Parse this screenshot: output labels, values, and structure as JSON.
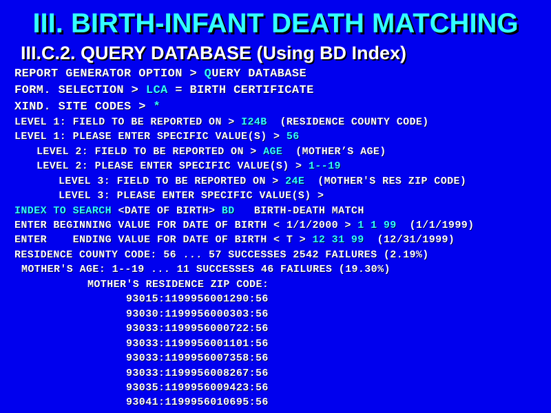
{
  "title": "III. BIRTH-INFANT DEATH MATCHING",
  "subtitle": "III.C.2. QUERY DATABASE (Using BD Index)",
  "lines": {
    "l1": {
      "a": "REPORT GENERATOR OPTION > ",
      "b": "Q",
      "c": "UERY DATABASE"
    },
    "l2": {
      "a": "FORM. SELECTION > ",
      "b": "LCA",
      "c": " = BIRTH CERTIFICATE"
    },
    "l3": {
      "a": "XIND. SITE CODES > ",
      "b": "*"
    },
    "l4": {
      "a": "LEVEL 1: FIELD TO BE REPORTED ON > ",
      "b": "I24B",
      "c": "  (RESIDENCE COUNTY CODE)"
    },
    "l5": {
      "a": "LEVEL 1: PLEASE ENTER SPECIFIC VALUE(S) > ",
      "b": "56"
    },
    "l6": {
      "a": "LEVEL 2: FIELD TO BE REPORTED ON > ",
      "b": "AGE",
      "c": "  (MOTHER’S AGE)"
    },
    "l7": {
      "a": "LEVEL 2: PLEASE ENTER SPECIFIC VALUE(S) > ",
      "b": "1--19"
    },
    "l8": {
      "a": "LEVEL 3: FIELD TO BE REPORTED ON > ",
      "b": "24E",
      "c": "  (MOTHER'S RES ZIP CODE)"
    },
    "l9": {
      "a": "LEVEL 3: PLEASE ENTER SPECIFIC VALUE(S) >"
    },
    "l10": {
      "a": "INDEX TO SEARCH ",
      "b": "<DATE OF BIRTH> ",
      "c": "BD",
      "d": "   BIRTH-DEATH MATCH"
    },
    "l11": {
      "a": "ENTER BEGINNING VALUE FOR DATE OF BIRTH < 1/1/2000 > ",
      "b": "1 1 99",
      "c": "  (1/1/1999)"
    },
    "l12": {
      "a": "ENTER    ENDING VALUE FOR DATE OF BIRTH < T > ",
      "b": "12 31 99",
      "c": "  (12/31/1999)"
    },
    "l13": {
      "a": "RESIDENCE COUNTY CODE: 56 ... 57 SUCCESSES 2542 FAILURES (2.19%)"
    },
    "l14": {
      "a": "MOTHER'S AGE: 1--19 ... 11 SUCCESSES 46 FAILURES (19.30%)"
    },
    "l15": {
      "a": "MOTHER'S RESIDENCE ZIP CODE:"
    }
  },
  "zip_records": [
    "93015:1199956001290:56",
    "93030:1199956000303:56",
    "93033:1199956000722:56",
    "93033:1199956001101:56",
    "93033:1199956007358:56",
    "93033:1199956008267:56",
    "93035:1199956009423:56",
    "93041:1199956010695:56"
  ],
  "colors": {
    "background": "#0000ee",
    "title": "#33ffff",
    "highlight": "#33ffff",
    "text": "#ffffff"
  }
}
